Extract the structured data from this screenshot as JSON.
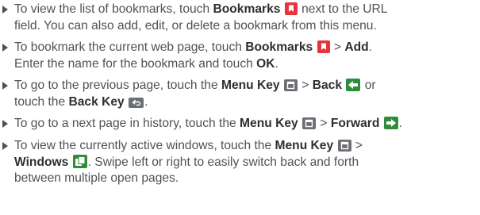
{
  "items": [
    {
      "lines": [
        [
          "To view the list of bookmarks, touch ",
          "Bookmarks",
          "",
          " next to the URL"
        ],
        [
          "field. You can also add, edit, or delete a bookmark from this menu."
        ]
      ]
    },
    {
      "lines": [
        [
          "To bookmark the current web page, touch ",
          "Bookmarks",
          "",
          " > ",
          "Add",
          "."
        ],
        [
          "Enter the name for the bookmark and touch ",
          "OK",
          "."
        ]
      ]
    },
    {
      "lines": [
        [
          "To go to the previous page, touch the ",
          "Menu Key",
          "",
          " > ",
          "Back",
          "",
          " or"
        ],
        [
          "touch the ",
          "Back Key",
          "",
          "."
        ]
      ]
    },
    {
      "lines": [
        [
          "To go to a next page in history, touch the ",
          "Menu Key",
          "",
          " > ",
          "Forward",
          "",
          "."
        ]
      ]
    },
    {
      "lines": [
        [
          "To view the currently active windows, touch the ",
          "Menu Key",
          "",
          " >"
        ],
        [
          "Windows",
          "",
          ". Swipe left or right to easily switch back and forth"
        ],
        [
          "between multiple open pages."
        ]
      ]
    }
  ],
  "icons": {
    "bookmark": "bookmark-icon",
    "menu_key": "menu-key-icon",
    "back": "back-arrow-icon",
    "back_key": "back-key-icon",
    "forward": "forward-arrow-icon",
    "windows": "windows-icon"
  },
  "colors": {
    "bookmark_red": "#e8323c",
    "key_gray": "#6b6e72",
    "nav_green": "#2f8c3a"
  }
}
